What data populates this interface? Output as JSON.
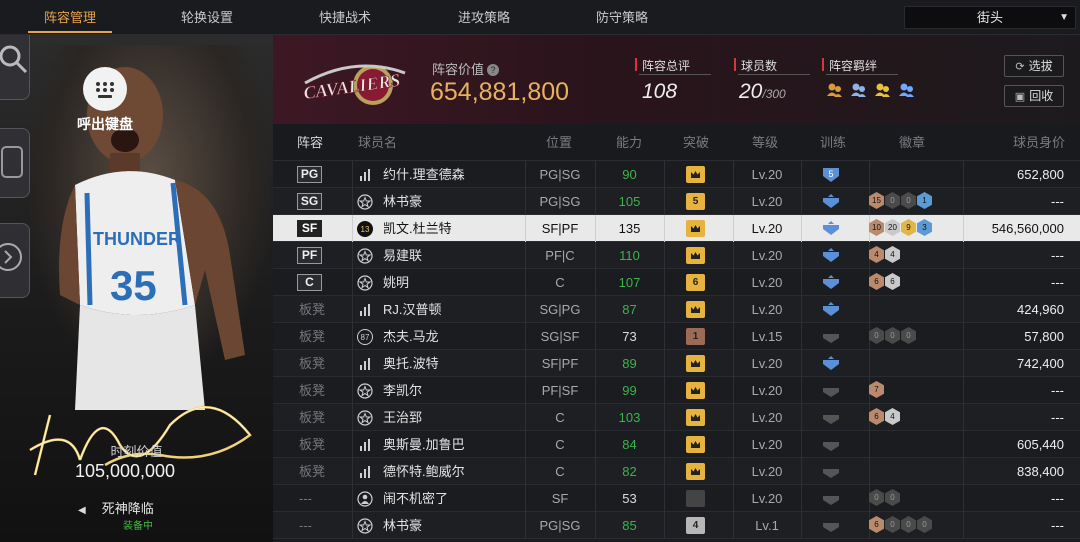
{
  "tabs": [
    "阵容管理",
    "轮换设置",
    "快捷战术",
    "进攻策略",
    "防守策略"
  ],
  "active_tab": 0,
  "mode_select": {
    "value": "街头"
  },
  "player_card": {
    "keyboard_label": "呼出键盘",
    "jersey": "35",
    "team_text": "THUNDER",
    "moment_label": "时刻价值",
    "moment_value": "105,000,000",
    "skill_name": "死神降临",
    "skill_status": "装备中"
  },
  "team": {
    "logo_text": "CAVALIERS",
    "value_label": "阵容价值",
    "value": "654,881,800",
    "overall_label": "阵容总评",
    "overall": "108",
    "players_label": "球员数",
    "players": "20",
    "players_max": "/300",
    "bond_label": "阵容羁绊",
    "bond_colors": [
      "#d89a3a",
      "#8fb3e8",
      "#e7c23c",
      "#6fa8ff"
    ],
    "pick_button": "选拔",
    "recycle_button": "回收"
  },
  "table": {
    "headers": [
      "阵容",
      "球员名",
      "位置",
      "能力",
      "突破",
      "等级",
      "训练",
      "徽章",
      "球员身价"
    ],
    "rows": [
      {
        "slot": "PG",
        "starter": true,
        "rank": "bars",
        "name": "约什.理查德森",
        "pos": "PG|SG",
        "ability": "90",
        "abil_color": "#3bb34a",
        "bt": "crown",
        "bt_style": "gold",
        "level": "Lv.20",
        "train": "5",
        "badges": [],
        "value": "652,800"
      },
      {
        "slot": "SG",
        "starter": true,
        "rank": "star",
        "name": "林书豪",
        "pos": "PG|SG",
        "ability": "105",
        "abil_color": "#3bb34a",
        "bt": "5",
        "bt_style": "gold",
        "level": "Lv.20",
        "train": "",
        "badges": [
          [
            "b",
            "15"
          ],
          [
            "d",
            "0"
          ],
          [
            "d",
            "0"
          ],
          [
            "bl",
            "1"
          ]
        ],
        "value": "---"
      },
      {
        "slot": "SF",
        "starter": true,
        "rank": "13",
        "name": "凯文.杜兰特",
        "pos": "SF|PF",
        "ability": "135",
        "abil_color": "#111111",
        "bt": "crown",
        "bt_style": "gold",
        "level": "Lv.20",
        "train": "",
        "badges": [
          [
            "b",
            "10"
          ],
          [
            "s",
            "20"
          ],
          [
            "g",
            "9"
          ],
          [
            "bl",
            "3"
          ]
        ],
        "value": "546,560,000",
        "selected": true
      },
      {
        "slot": "PF",
        "starter": true,
        "rank": "star",
        "name": "易建联",
        "pos": "PF|C",
        "ability": "110",
        "abil_color": "#3bb34a",
        "bt": "crown",
        "bt_style": "gold",
        "level": "Lv.20",
        "train": "",
        "badges": [
          [
            "b",
            "4"
          ],
          [
            "s",
            "4"
          ]
        ],
        "value": "---"
      },
      {
        "slot": "C",
        "starter": true,
        "rank": "star",
        "name": "姚明",
        "pos": "C",
        "ability": "107",
        "abil_color": "#3bb34a",
        "bt": "6",
        "bt_style": "gold",
        "level": "Lv.20",
        "train": "",
        "badges": [
          [
            "b",
            "6"
          ],
          [
            "s",
            "6"
          ]
        ],
        "value": "---"
      },
      {
        "slot": "板凳",
        "starter": false,
        "rank": "bars",
        "name": "RJ.汉普顿",
        "pos": "SG|PG",
        "ability": "87",
        "abil_color": "#3bb34a",
        "bt": "crown",
        "bt_style": "gold",
        "level": "Lv.20",
        "train": "",
        "badges": [],
        "value": "424,960"
      },
      {
        "slot": "板凳",
        "starter": false,
        "rank": "87",
        "name": "杰夫.马龙",
        "pos": "SG|SF",
        "ability": "73",
        "abil_color": "#dddddd",
        "bt": "1",
        "bt_style": "brown",
        "level": "Lv.15",
        "train": "",
        "badges": [
          [
            "d",
            "0"
          ],
          [
            "d",
            "0"
          ],
          [
            "d",
            "0"
          ]
        ],
        "value": "57,800"
      },
      {
        "slot": "板凳",
        "starter": false,
        "rank": "bars",
        "name": "奥托.波特",
        "pos": "SF|PF",
        "ability": "89",
        "abil_color": "#3bb34a",
        "bt": "crown",
        "bt_style": "gold",
        "level": "Lv.20",
        "train": "",
        "badges": [],
        "value": "742,400"
      },
      {
        "slot": "板凳",
        "starter": false,
        "rank": "star",
        "name": "李凯尔",
        "pos": "PF|SF",
        "ability": "99",
        "abil_color": "#3bb34a",
        "bt": "crown",
        "bt_style": "gold",
        "level": "Lv.20",
        "train": "",
        "badges": [
          [
            "b",
            "7"
          ]
        ],
        "value": "---"
      },
      {
        "slot": "板凳",
        "starter": false,
        "rank": "star",
        "name": "王治郅",
        "pos": "C",
        "ability": "103",
        "abil_color": "#3bb34a",
        "bt": "crown",
        "bt_style": "gold",
        "level": "Lv.20",
        "train": "",
        "badges": [
          [
            "b",
            "6"
          ],
          [
            "s",
            "4"
          ]
        ],
        "value": "---"
      },
      {
        "slot": "板凳",
        "starter": false,
        "rank": "bars",
        "name": "奥斯曼.加鲁巴",
        "pos": "C",
        "ability": "84",
        "abil_color": "#3bb34a",
        "bt": "crown",
        "bt_style": "gold",
        "level": "Lv.20",
        "train": "",
        "badges": [],
        "value": "605,440"
      },
      {
        "slot": "板凳",
        "starter": false,
        "rank": "bars",
        "name": "德怀特.鲍威尔",
        "pos": "C",
        "ability": "82",
        "abil_color": "#3bb34a",
        "bt": "crown",
        "bt_style": "gold",
        "level": "Lv.20",
        "train": "",
        "badges": [],
        "value": "838,400"
      },
      {
        "slot": "---",
        "starter": false,
        "rank": "person",
        "name": "闹不机密了",
        "pos": "SF",
        "ability": "53",
        "abil_color": "#dddddd",
        "bt": "",
        "bt_style": "gray",
        "level": "Lv.20",
        "train": "",
        "badges": [
          [
            "d",
            "0"
          ],
          [
            "d",
            "0"
          ]
        ],
        "value": "---"
      },
      {
        "slot": "---",
        "starter": false,
        "rank": "star",
        "name": "林书豪",
        "pos": "PG|SG",
        "ability": "85",
        "abil_color": "#3bb34a",
        "bt": "4",
        "bt_style": "light",
        "level": "Lv.1",
        "train": "",
        "badges": [
          [
            "b",
            "6"
          ],
          [
            "d",
            "0"
          ],
          [
            "d",
            "0"
          ],
          [
            "d",
            "0"
          ]
        ],
        "value": "---"
      }
    ]
  }
}
